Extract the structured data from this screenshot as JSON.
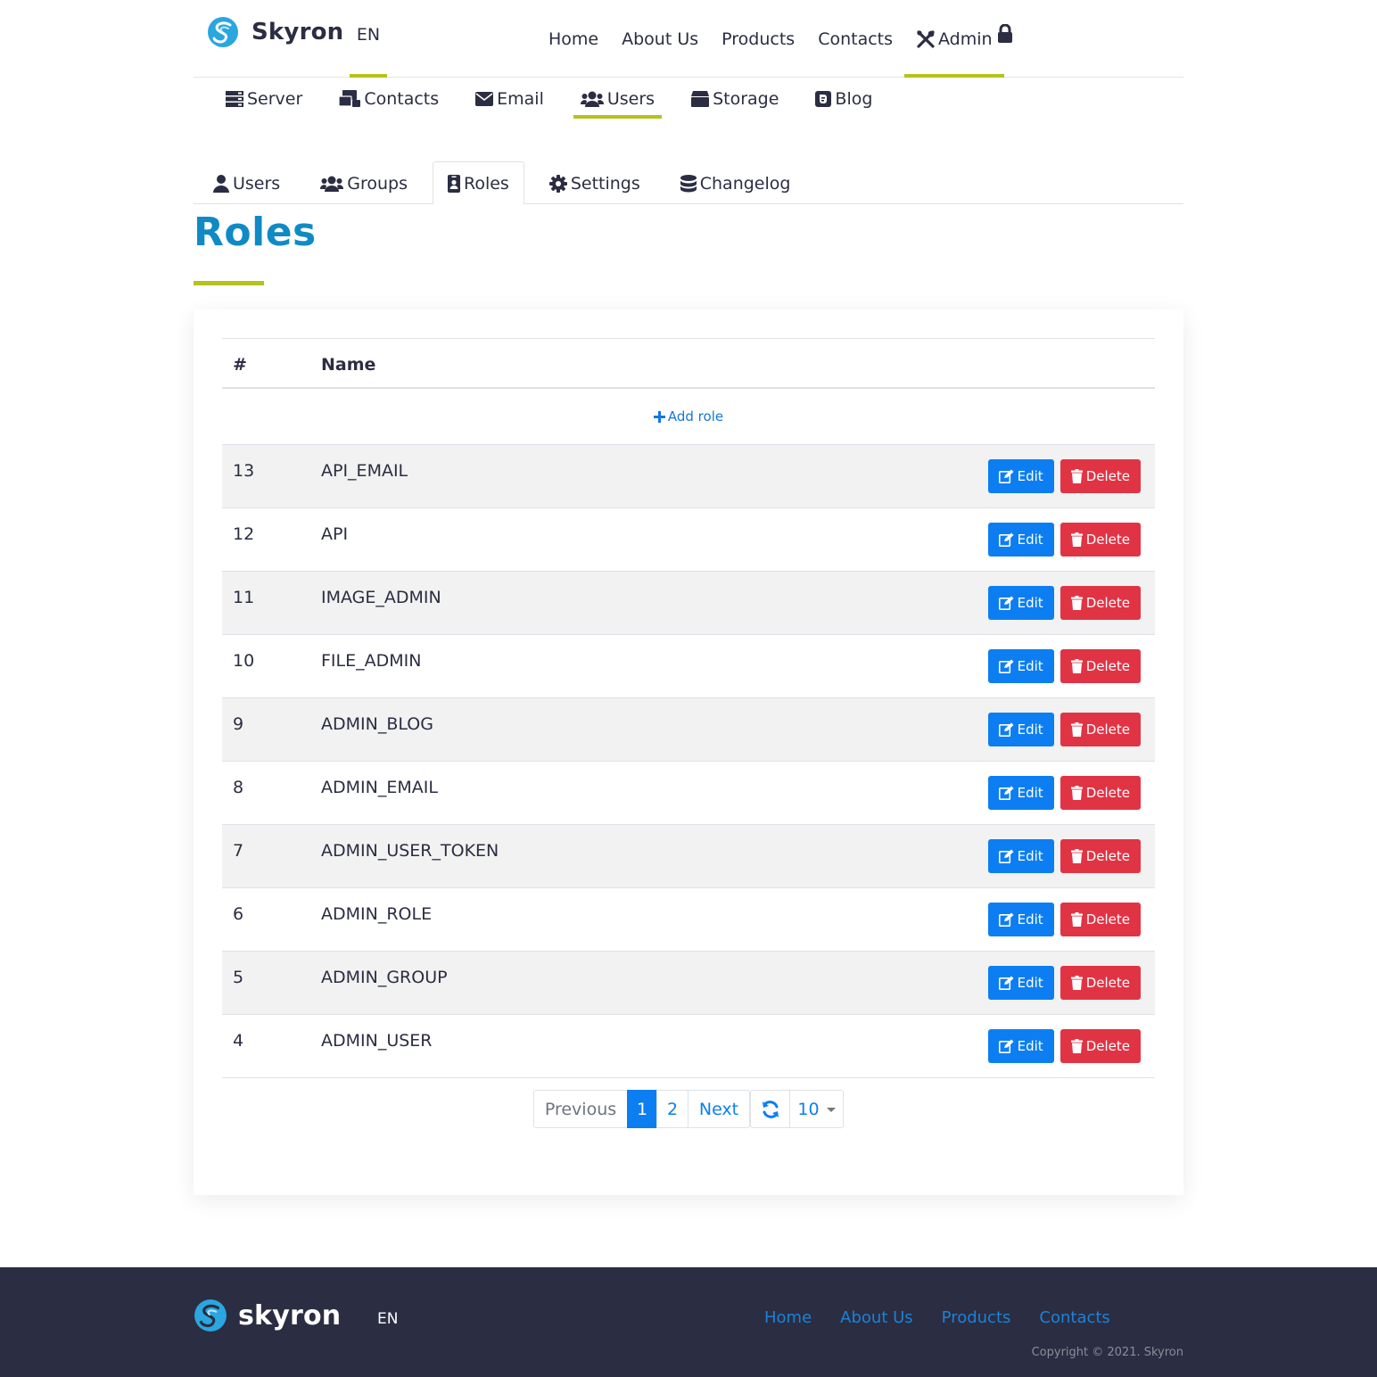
{
  "brand": {
    "name": "Skyron",
    "lang": "EN"
  },
  "main_nav": [
    {
      "label": "Home",
      "icon": ""
    },
    {
      "label": "About Us",
      "icon": ""
    },
    {
      "label": "Products",
      "icon": ""
    },
    {
      "label": "Contacts",
      "icon": ""
    },
    {
      "label": "Admin",
      "icon": "tools-icon",
      "active": true
    }
  ],
  "sub_nav": [
    {
      "label": "Server",
      "icon": "server-icon"
    },
    {
      "label": "Contacts",
      "icon": "contacts-icon"
    },
    {
      "label": "Email",
      "icon": "envelope-icon"
    },
    {
      "label": "Users",
      "icon": "users-icon",
      "active": true
    },
    {
      "label": "Storage",
      "icon": "archive-icon"
    },
    {
      "label": "Blog",
      "icon": "blog-icon"
    }
  ],
  "tabs": [
    {
      "label": "Users",
      "icon": "user-icon"
    },
    {
      "label": "Groups",
      "icon": "users-icon"
    },
    {
      "label": "Roles",
      "icon": "id-badge-icon",
      "active": true
    },
    {
      "label": "Settings",
      "icon": "gear-icon"
    },
    {
      "label": "Changelog",
      "icon": "database-icon"
    }
  ],
  "page_title": "Roles",
  "table": {
    "headers": {
      "id": "#",
      "name": "Name"
    },
    "add_label": "Add role",
    "edit_label": "Edit",
    "delete_label": "Delete",
    "rows": [
      {
        "id": "13",
        "name": "API_EMAIL"
      },
      {
        "id": "12",
        "name": "API"
      },
      {
        "id": "11",
        "name": "IMAGE_ADMIN"
      },
      {
        "id": "10",
        "name": "FILE_ADMIN"
      },
      {
        "id": "9",
        "name": "ADMIN_BLOG"
      },
      {
        "id": "8",
        "name": "ADMIN_EMAIL"
      },
      {
        "id": "7",
        "name": "ADMIN_USER_TOKEN"
      },
      {
        "id": "6",
        "name": "ADMIN_ROLE"
      },
      {
        "id": "5",
        "name": "ADMIN_GROUP"
      },
      {
        "id": "4",
        "name": "ADMIN_USER"
      }
    ]
  },
  "pagination": {
    "previous": "Previous",
    "pages": [
      "1",
      "2"
    ],
    "current_page": "1",
    "next": "Next",
    "page_size": "10"
  },
  "footer": {
    "brand": "skyron",
    "lang": "EN",
    "links": [
      "Home",
      "About Us",
      "Products",
      "Contacts"
    ],
    "copyright": "Copyright © 2021. Skyron"
  },
  "colors": {
    "accent": "#b5c21f",
    "title": "#0f8ac4",
    "primary": "#0d7ef2",
    "danger": "#e03445",
    "footer_bg": "#2b2d42"
  }
}
